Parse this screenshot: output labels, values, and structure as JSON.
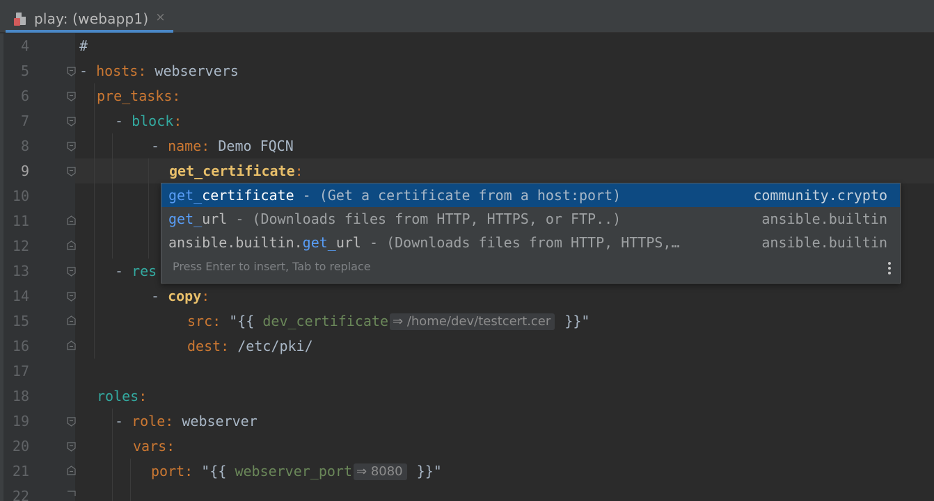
{
  "tab": {
    "title": "play: (webapp1)",
    "close": "×"
  },
  "line_numbers": [
    "4",
    "5",
    "6",
    "7",
    "8",
    "9",
    "10",
    "11",
    "12",
    "13",
    "14",
    "15",
    "16",
    "17",
    "18",
    "19",
    "20",
    "21",
    "22"
  ],
  "code": {
    "l4": "#",
    "l5_dash": "- ",
    "l5_key": "hosts",
    "l5_colon": ": ",
    "l5_val": "webservers",
    "l6_key": "pre_tasks",
    "l6_colon": ":",
    "l7_dash": "- ",
    "l7_key": "block",
    "l7_colon": ":",
    "l8_dash": "- ",
    "l8_key": "name",
    "l8_colon": ": ",
    "l8_val": "Demo FQCN",
    "l9_key": "get_certificate",
    "l9_colon": ":",
    "l13_dash": "- ",
    "l13_key": "res",
    "l14_dash": "- ",
    "l14_key": "copy",
    "l14_colon": ":",
    "l15_key": "src",
    "l15_colon": ": ",
    "l15_open": "\"{{ ",
    "l15_var": "dev_certificate",
    "l15_hint": "⇒ /home/dev/testcert.cer",
    "l15_close": " }}\"",
    "l16_key": "dest",
    "l16_colon": ": ",
    "l16_val": "/etc/pki/",
    "l18_key": "roles",
    "l18_colon": ":",
    "l19_dash": "- ",
    "l19_key": "role",
    "l19_colon": ": ",
    "l19_val": "webserver",
    "l20_key": "vars",
    "l20_colon": ":",
    "l21_key": "port",
    "l21_colon": ": ",
    "l21_open": "\"{{ ",
    "l21_var": "webserver_port",
    "l21_hint": "⇒ 8080",
    "l21_close": " }}\""
  },
  "completion": {
    "items": [
      {
        "prefix": "",
        "match": "get_",
        "rest": "certificate",
        "desc": " - (Get a certificate from a host:port)",
        "source": "community.crypto"
      },
      {
        "prefix": "",
        "match": "get_",
        "rest": "url",
        "desc": " - (Downloads files from HTTP, HTTPS, or FTP..)",
        "source": "ansible.builtin"
      },
      {
        "prefix": "ansible.builtin.",
        "match": "get_",
        "rest": "url",
        "desc": " - (Downloads files from HTTP, HTTPS,…",
        "source": "ansible.builtin"
      }
    ],
    "hint": "Press Enter to insert, Tab to replace"
  },
  "colors": {
    "background": "#2b2b2b",
    "gutter": "#313335",
    "keyword": "#cc7832",
    "bold_key": "#e8bf6a",
    "module_key": "#33aaa0",
    "selection": "#0d4a82",
    "match": "#589df6"
  },
  "icons": [
    "yaml-file-icon",
    "close-icon",
    "fold-icon",
    "more-options-icon"
  ]
}
